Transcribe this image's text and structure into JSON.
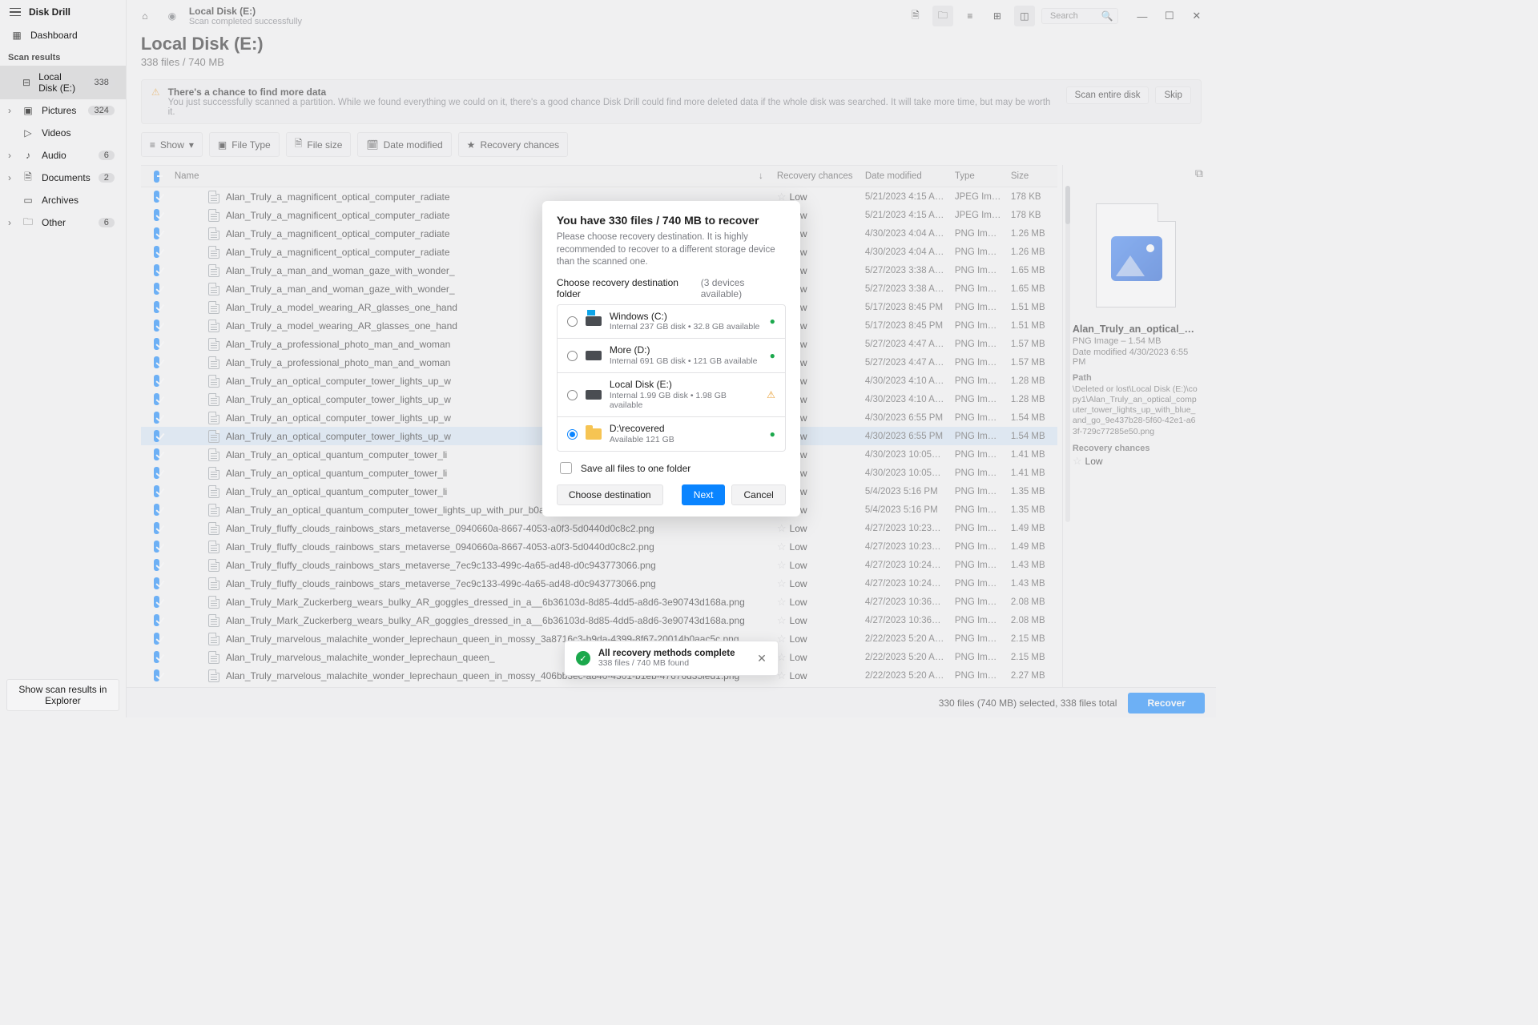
{
  "app_title": "Disk Drill",
  "dashboard_label": "Dashboard",
  "scan_results_heading": "Scan results",
  "sidebar_items": [
    {
      "label": "Local Disk (E:)",
      "count": "338",
      "active": true,
      "icon": "drive-icon",
      "expand": false
    },
    {
      "label": "Pictures",
      "count": "324",
      "icon": "picture-icon",
      "expand": true
    },
    {
      "label": "Videos",
      "count": "",
      "icon": "video-icon",
      "expand": false
    },
    {
      "label": "Audio",
      "count": "6",
      "icon": "audio-icon",
      "expand": true
    },
    {
      "label": "Documents",
      "count": "2",
      "icon": "document-icon",
      "expand": true
    },
    {
      "label": "Archives",
      "count": "",
      "icon": "archive-icon",
      "expand": false
    },
    {
      "label": "Other",
      "count": "6",
      "icon": "other-icon",
      "expand": true
    }
  ],
  "sidebar_footer": "Show scan results in Explorer",
  "crumb": {
    "title": "Local Disk (E:)",
    "sub": "Scan completed successfully"
  },
  "search_placeholder": "Search",
  "page": {
    "title": "Local Disk (E:)",
    "sub": "338 files / 740 MB"
  },
  "alert": {
    "title": "There's a chance to find more data",
    "desc": "You just successfully scanned a partition. While we found everything we could on it, there's a good chance Disk Drill could find more deleted data if the whole disk was searched. It will take more time, but may be worth it.",
    "primary": "Scan entire disk",
    "skip": "Skip"
  },
  "filters": {
    "show": "Show",
    "file_type": "File Type",
    "file_size": "File size",
    "date_mod": "Date modified",
    "recovery": "Recovery chances"
  },
  "columns": {
    "name": "Name",
    "recovery": "Recovery chances",
    "date": "Date modified",
    "type": "Type",
    "size": "Size"
  },
  "rows": [
    {
      "name": "Alan_Truly_a_magnificent_optical_computer_radiate",
      "rec": "Low",
      "date": "5/21/2023 4:15 A…",
      "type": "JPEG Im…",
      "size": "178 KB"
    },
    {
      "name": "Alan_Truly_a_magnificent_optical_computer_radiate",
      "rec": "Low",
      "date": "5/21/2023 4:15 A…",
      "type": "JPEG Im…",
      "size": "178 KB"
    },
    {
      "name": "Alan_Truly_a_magnificent_optical_computer_radiate",
      "rec": "Low",
      "date": "4/30/2023 4:04 A…",
      "type": "PNG Im…",
      "size": "1.26 MB"
    },
    {
      "name": "Alan_Truly_a_magnificent_optical_computer_radiate",
      "rec": "Low",
      "date": "4/30/2023 4:04 A…",
      "type": "PNG Im…",
      "size": "1.26 MB"
    },
    {
      "name": "Alan_Truly_a_man_and_woman_gaze_with_wonder_",
      "rec": "Low",
      "date": "5/27/2023 3:38 A…",
      "type": "PNG Im…",
      "size": "1.65 MB"
    },
    {
      "name": "Alan_Truly_a_man_and_woman_gaze_with_wonder_",
      "rec": "Low",
      "date": "5/27/2023 3:38 A…",
      "type": "PNG Im…",
      "size": "1.65 MB"
    },
    {
      "name": "Alan_Truly_a_model_wearing_AR_glasses_one_hand",
      "rec": "Low",
      "date": "5/17/2023 8:45 PM",
      "type": "PNG Im…",
      "size": "1.51 MB"
    },
    {
      "name": "Alan_Truly_a_model_wearing_AR_glasses_one_hand",
      "rec": "Low",
      "date": "5/17/2023 8:45 PM",
      "type": "PNG Im…",
      "size": "1.51 MB"
    },
    {
      "name": "Alan_Truly_a_professional_photo_man_and_woman",
      "rec": "Low",
      "date": "5/27/2023 4:47 A…",
      "type": "PNG Im…",
      "size": "1.57 MB"
    },
    {
      "name": "Alan_Truly_a_professional_photo_man_and_woman",
      "rec": "Low",
      "date": "5/27/2023 4:47 A…",
      "type": "PNG Im…",
      "size": "1.57 MB"
    },
    {
      "name": "Alan_Truly_an_optical_computer_tower_lights_up_w",
      "rec": "Low",
      "date": "4/30/2023 4:10 A…",
      "type": "PNG Im…",
      "size": "1.28 MB"
    },
    {
      "name": "Alan_Truly_an_optical_computer_tower_lights_up_w",
      "rec": "Low",
      "date": "4/30/2023 4:10 A…",
      "type": "PNG Im…",
      "size": "1.28 MB"
    },
    {
      "name": "Alan_Truly_an_optical_computer_tower_lights_up_w",
      "rec": "Low",
      "date": "4/30/2023 6:55 PM",
      "type": "PNG Im…",
      "size": "1.54 MB"
    },
    {
      "name": "Alan_Truly_an_optical_computer_tower_lights_up_w",
      "rec": "Low",
      "date": "4/30/2023 6:55 PM",
      "type": "PNG Im…",
      "size": "1.54 MB",
      "sel": true
    },
    {
      "name": "Alan_Truly_an_optical_quantum_computer_tower_li",
      "rec": "Low",
      "date": "4/30/2023 10:05…",
      "type": "PNG Im…",
      "size": "1.41 MB"
    },
    {
      "name": "Alan_Truly_an_optical_quantum_computer_tower_li",
      "rec": "Low",
      "date": "4/30/2023 10:05…",
      "type": "PNG Im…",
      "size": "1.41 MB"
    },
    {
      "name": "Alan_Truly_an_optical_quantum_computer_tower_li",
      "rec": "Low",
      "date": "5/4/2023 5:16 PM",
      "type": "PNG Im…",
      "size": "1.35 MB"
    },
    {
      "name": "Alan_Truly_an_optical_quantum_computer_tower_lights_up_with_pur_b0a05a75-2f45-4795-b27e-125ea1a35ccb.png",
      "rec": "Low",
      "date": "5/4/2023 5:16 PM",
      "type": "PNG Im…",
      "size": "1.35 MB"
    },
    {
      "name": "Alan_Truly_fluffy_clouds_rainbows_stars_metaverse_0940660a-8667-4053-a0f3-5d0440d0c8c2.png",
      "rec": "Low",
      "date": "4/27/2023 10:23…",
      "type": "PNG Im…",
      "size": "1.49 MB"
    },
    {
      "name": "Alan_Truly_fluffy_clouds_rainbows_stars_metaverse_0940660a-8667-4053-a0f3-5d0440d0c8c2.png",
      "rec": "Low",
      "date": "4/27/2023 10:23…",
      "type": "PNG Im…",
      "size": "1.49 MB"
    },
    {
      "name": "Alan_Truly_fluffy_clouds_rainbows_stars_metaverse_7ec9c133-499c-4a65-ad48-d0c943773066.png",
      "rec": "Low",
      "date": "4/27/2023 10:24…",
      "type": "PNG Im…",
      "size": "1.43 MB"
    },
    {
      "name": "Alan_Truly_fluffy_clouds_rainbows_stars_metaverse_7ec9c133-499c-4a65-ad48-d0c943773066.png",
      "rec": "Low",
      "date": "4/27/2023 10:24…",
      "type": "PNG Im…",
      "size": "1.43 MB"
    },
    {
      "name": "Alan_Truly_Mark_Zuckerberg_wears_bulky_AR_goggles_dressed_in_a__6b36103d-8d85-4dd5-a8d6-3e90743d168a.png",
      "rec": "Low",
      "date": "4/27/2023 10:36…",
      "type": "PNG Im…",
      "size": "2.08 MB"
    },
    {
      "name": "Alan_Truly_Mark_Zuckerberg_wears_bulky_AR_goggles_dressed_in_a__6b36103d-8d85-4dd5-a8d6-3e90743d168a.png",
      "rec": "Low",
      "date": "4/27/2023 10:36…",
      "type": "PNG Im…",
      "size": "2.08 MB"
    },
    {
      "name": "Alan_Truly_marvelous_malachite_wonder_leprechaun_queen_in_mossy_3a8716c3-b9da-4399-8f67-20014b0aac5c.png",
      "rec": "Low",
      "date": "2/22/2023 5:20 A…",
      "type": "PNG Im…",
      "size": "2.15 MB"
    },
    {
      "name": "Alan_Truly_marvelous_malachite_wonder_leprechaun_queen_",
      "rec": "Low",
      "date": "2/22/2023 5:20 A…",
      "type": "PNG Im…",
      "size": "2.15 MB"
    },
    {
      "name": "Alan_Truly_marvelous_malachite_wonder_leprechaun_queen_in_mossy_406bb3ec-a840-4301-b1eb-47676d35ied1.png",
      "rec": "Low",
      "date": "2/22/2023 5:20 A…",
      "type": "PNG Im…",
      "size": "2.27 MB"
    }
  ],
  "preview": {
    "title": "Alan_Truly_an_optical_com…",
    "meta1": "PNG Image – 1.54 MB",
    "meta2": "Date modified 4/30/2023 6:55 PM",
    "path_label": "Path",
    "path": "\\Deleted or lost\\Local Disk (E:)\\copy1\\Alan_Truly_an_optical_computer_tower_lights_up_with_blue_and_go_9e437b28-5f60-42e1-a63f-729c77285e50.png",
    "rec_label": "Recovery chances",
    "rec_value": "Low"
  },
  "status": {
    "text": "330 files (740 MB) selected, 338 files total",
    "recover": "Recover"
  },
  "modal": {
    "title": "You have 330 files / 740 MB to recover",
    "desc": "Please choose recovery destination. It is highly recommended to recover to a different storage device than the scanned one.",
    "sec": "Choose recovery destination folder",
    "count": "(3 devices available)",
    "dests": [
      {
        "name": "Windows (C:)",
        "sub": "Internal 237 GB disk • 32.8 GB available",
        "icon": "win",
        "status": "ok"
      },
      {
        "name": "More (D:)",
        "sub": "Internal 691 GB disk • 121 GB available",
        "icon": "drive",
        "status": "ok"
      },
      {
        "name": "Local Disk (E:)",
        "sub": "Internal 1.99 GB disk • 1.98 GB available",
        "icon": "drive",
        "status": "warn"
      },
      {
        "name": "D:\\recovered",
        "sub": "Available 121 GB",
        "icon": "folder",
        "status": "ok",
        "sel": true
      }
    ],
    "save_one": "Save all files to one folder",
    "choose": "Choose destination",
    "next": "Next",
    "cancel": "Cancel"
  },
  "toast": {
    "title": "All recovery methods complete",
    "sub": "338 files / 740 MB found"
  }
}
